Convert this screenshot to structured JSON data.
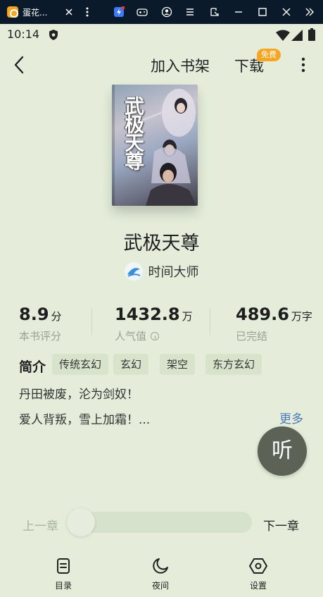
{
  "emulator": {
    "tab_title": "蛋花...",
    "icons": [
      "app-icon",
      "close-icon",
      "more-vertical-icon",
      "assistant-icon",
      "gamepad-icon",
      "account-icon",
      "menu-icon",
      "resize-icon",
      "minimize-icon",
      "maximize-icon",
      "close-icon",
      "expand-icon"
    ]
  },
  "status_bar": {
    "time": "10:14",
    "icons": [
      "shield-icon",
      "wifi-icon",
      "signal-icon",
      "battery-icon"
    ]
  },
  "header": {
    "add_to_shelf": "加入书架",
    "download": "下载",
    "free_badge": "免费",
    "icons": [
      "back-icon",
      "more-vertical-icon"
    ]
  },
  "book": {
    "cover_title": "武极天尊",
    "title": "武极天尊",
    "author": "时间大师"
  },
  "stats": {
    "rating": {
      "value": "8.9",
      "unit": "分",
      "label": "本书评分"
    },
    "popularity": {
      "value": "1432.8",
      "unit": "万",
      "label": "人气值"
    },
    "words": {
      "value": "489.6",
      "unit": "万字",
      "label": "已完结"
    }
  },
  "intro": {
    "label": "简介",
    "tags": [
      "传统玄幻",
      "玄幻",
      "架空",
      "东方玄幻"
    ],
    "lines": [
      "丹田被废，沦为剑奴！",
      "爱人背叛，雪上加霜！..."
    ],
    "more": "更多"
  },
  "listen": {
    "label": "听"
  },
  "chapter": {
    "prev": "上一章",
    "next": "下一章",
    "progress": 0
  },
  "bottom_nav": [
    {
      "label": "目录",
      "icon": "catalog-icon"
    },
    {
      "label": "夜间",
      "icon": "moon-icon"
    },
    {
      "label": "设置",
      "icon": "settings-icon"
    }
  ],
  "colors": {
    "background": "#e5edda",
    "accent_link": "#4c79b8",
    "badge": "#f6a623",
    "listen_button": "#5c6255",
    "emulator_bar": "#0b1a2b"
  }
}
